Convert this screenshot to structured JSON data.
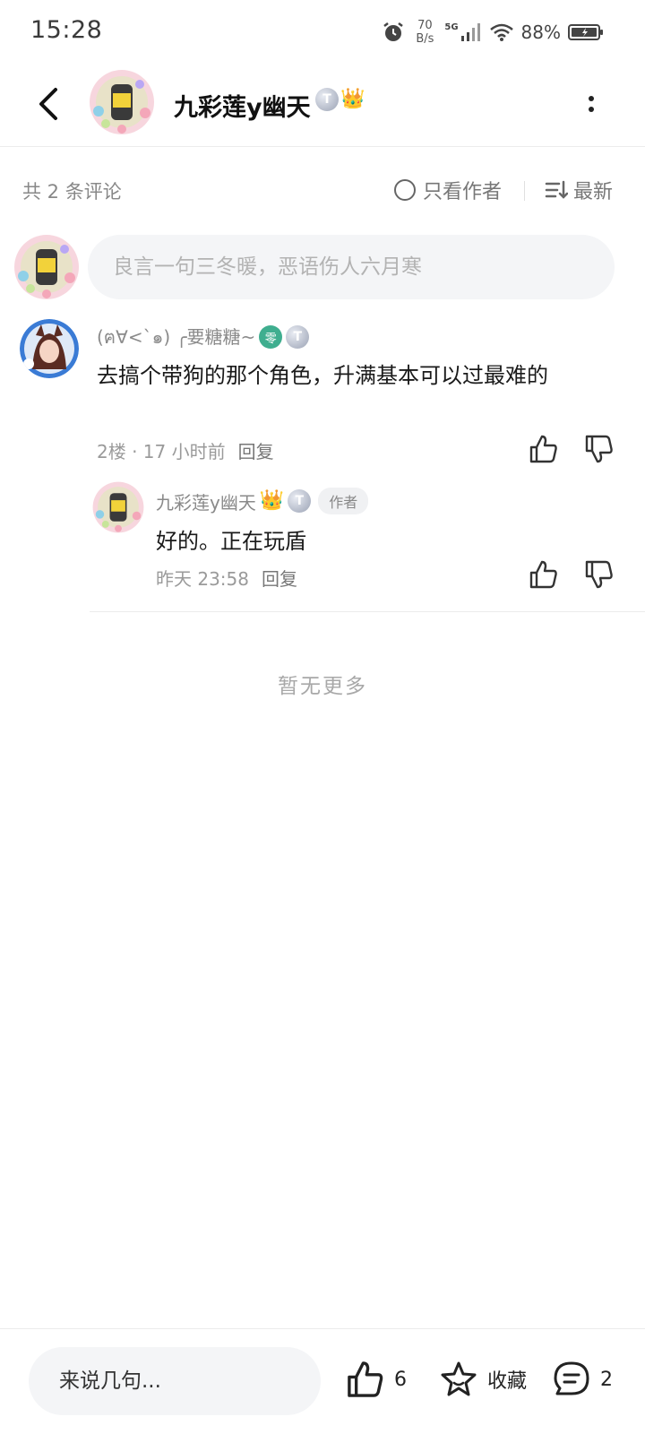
{
  "status_bar": {
    "time": "15:28",
    "net_speed_value": "70",
    "net_speed_unit": "B/s",
    "network": "5G",
    "battery": "88%"
  },
  "header": {
    "title": "九彩莲y幽天",
    "badge_t": "T",
    "badge_crown": "👑"
  },
  "comments_bar": {
    "count_text": "共 2 条评论",
    "author_only_label": "只看作者",
    "sort_label": "最新"
  },
  "comment_input": {
    "placeholder": "良言一句三冬暖，恶语伤人六月寒"
  },
  "comment": {
    "username": "(ฅ∀<`๑) ╭要糖糖~",
    "badge_green": "零",
    "badge_t": "T",
    "text": "去搞个带狗的那个角色，升满基本可以过最难的",
    "floor_time": "2楼 · 17 小时前",
    "reply_label": "回复"
  },
  "reply": {
    "username": "九彩莲y幽天",
    "badge_crown": "👑",
    "badge_t": "T",
    "author_tag": "作者",
    "text": "好的。正在玩盾",
    "time": "昨天 23:58",
    "reply_label": "回复"
  },
  "footer_text": "暂无更多",
  "bottom_bar": {
    "input_placeholder": "来说几句...",
    "like_count": "6",
    "favorite_label": "收藏",
    "comment_count": "2"
  },
  "colors": {
    "text_primary": "#1a1a1a",
    "text_secondary": "#8a8a8a",
    "input_bg": "#f4f5f7",
    "badge_green": "#3fae8f",
    "crown_gold": "#f2b705"
  }
}
